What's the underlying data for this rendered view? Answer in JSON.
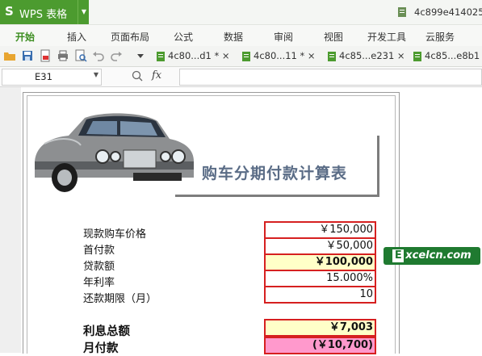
{
  "app": {
    "name": "WPS 表格",
    "logo_glyph": "S",
    "doc_title": "4c899e414025"
  },
  "ribbon": {
    "tabs": [
      "开始",
      "插入",
      "页面布局",
      "公式",
      "数据",
      "审阅",
      "视图",
      "开发工具",
      "云服务"
    ],
    "active": "开始"
  },
  "doc_tabs": [
    {
      "label": "4c80...d1 * ×"
    },
    {
      "label": "4c80...11 * ×"
    },
    {
      "label": "4c85...e231 ×"
    },
    {
      "label": "4c85...e8b1"
    }
  ],
  "formula_bar": {
    "cell_ref": "E31",
    "fx_label": "fx",
    "formula": ""
  },
  "sheet": {
    "title": "购车分期付款计算表",
    "rows": [
      {
        "label": "现款购车价格",
        "value": "￥150,000"
      },
      {
        "label": "首付款",
        "value": "￥50,000"
      },
      {
        "label": "贷款额",
        "value": "￥100,000"
      },
      {
        "label": "年利率",
        "value": "15.000%"
      },
      {
        "label": "还款期限（月）",
        "value": "10"
      }
    ],
    "totals": [
      {
        "label": "利息总额",
        "value": "￥7,003"
      },
      {
        "label": "月付款",
        "value": "(￥10,700)"
      }
    ]
  },
  "watermark": {
    "letter": "E",
    "text": "xcelcn.com"
  },
  "colors": {
    "accent": "#4c9b2f",
    "border_red": "#d62020",
    "highlight_yellow": "#ffffc8",
    "highlight_pink": "#ff99cc",
    "title_blue": "#5a6c86"
  }
}
